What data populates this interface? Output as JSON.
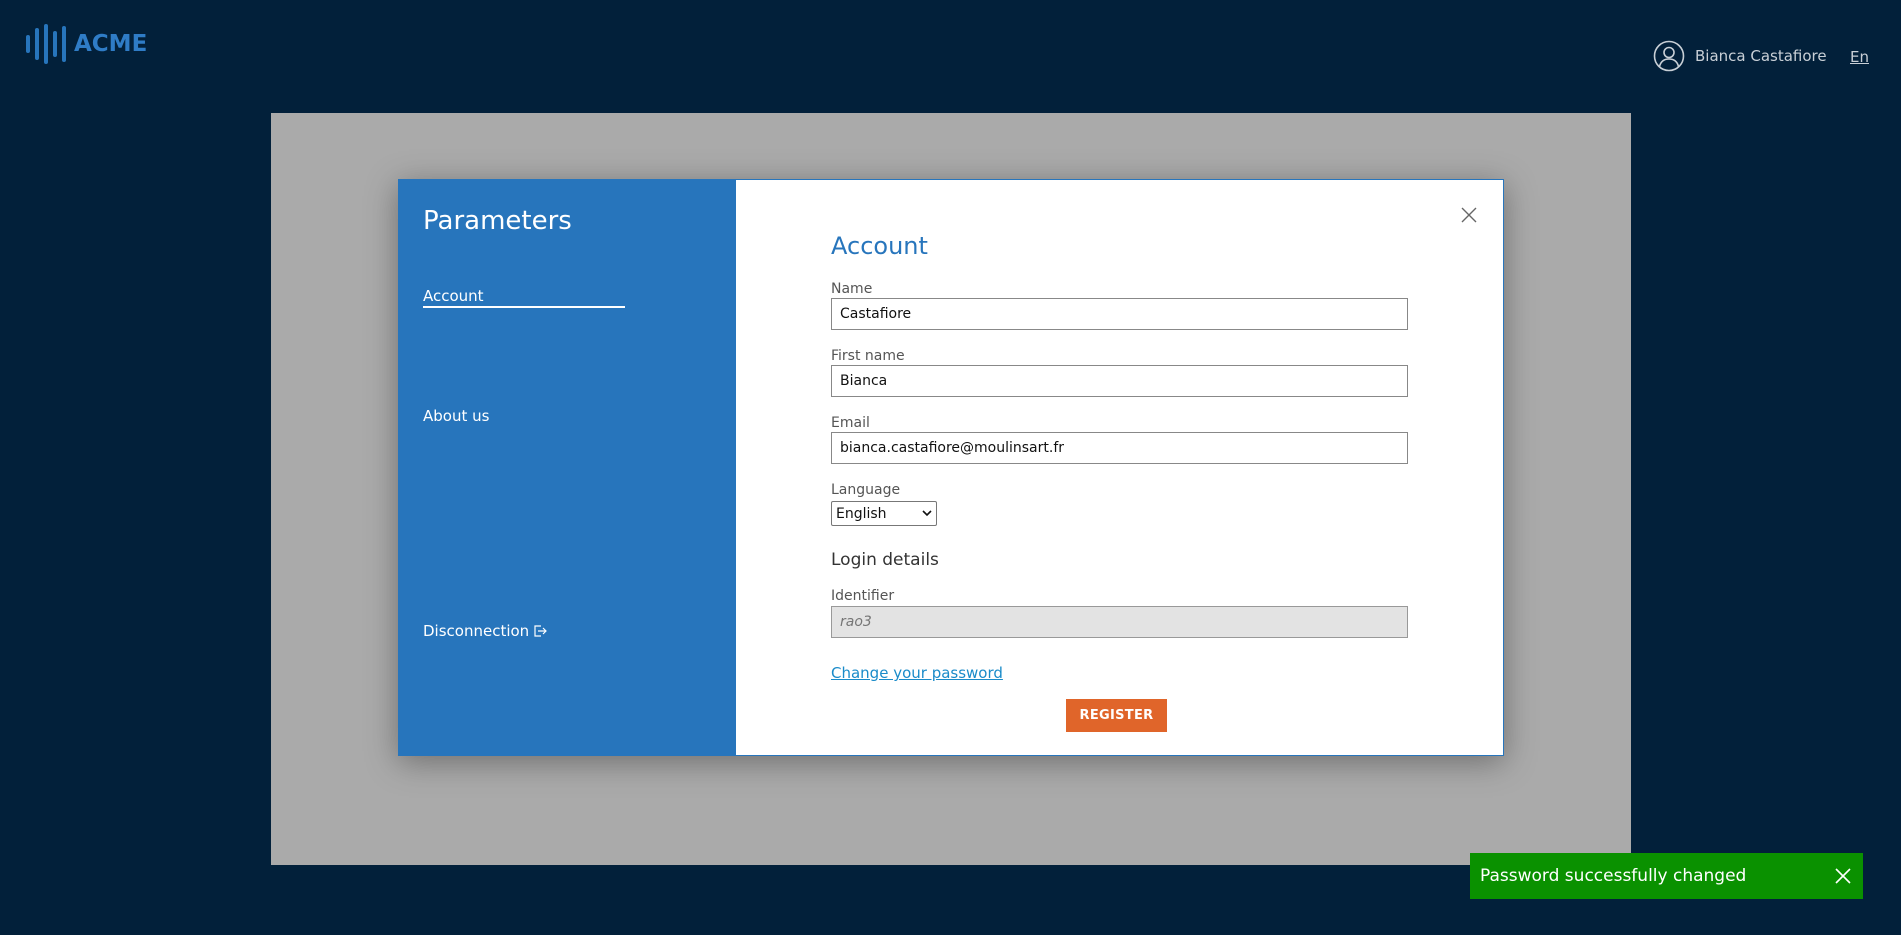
{
  "header": {
    "logo_text": "ACME",
    "user_name": "Bianca Castafiore",
    "language_code": "En"
  },
  "modal": {
    "sidebar": {
      "title": "Parameters",
      "items": [
        {
          "label": "Account",
          "active": true
        },
        {
          "label": "About us",
          "active": false
        },
        {
          "label": "Disconnection",
          "active": false
        }
      ]
    },
    "main": {
      "title": "Account",
      "fields": {
        "name": {
          "label": "Name",
          "value": "Castafiore"
        },
        "first_name": {
          "label": "First name",
          "value": "Bianca"
        },
        "email": {
          "label": "Email",
          "value": "bianca.castafiore@moulinsart.fr"
        },
        "language": {
          "label": "Language",
          "value": "English"
        }
      },
      "login_details": {
        "heading": "Login details",
        "identifier_label": "Identifier",
        "identifier_placeholder": "rao3"
      },
      "change_password_link": "Change your password",
      "register_button": "REGISTER"
    }
  },
  "toast": {
    "message": "Password successfully changed"
  },
  "colors": {
    "background": "#02203a",
    "accent": "#2775bc",
    "button": "#e0652a",
    "toast": "#0a9100"
  }
}
